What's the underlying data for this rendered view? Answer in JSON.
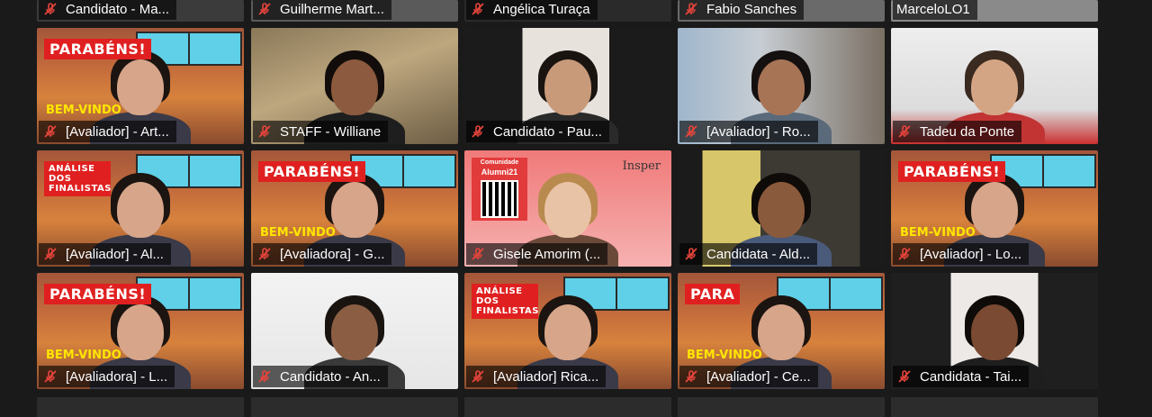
{
  "top_row": [
    {
      "name": "Candidato - Ma...",
      "muted": true
    },
    {
      "name": "Guilherme Mart...",
      "muted": true
    },
    {
      "name": "Angélica Turaça",
      "muted": true
    },
    {
      "name": "Fabio Sanches",
      "muted": true
    },
    {
      "name": "MarceloLO1",
      "muted": false
    }
  ],
  "tiles": [
    {
      "name": "[Avaliador] - Art...",
      "muted": true,
      "banner": "PARABÉNS!",
      "overlay": "BEM-VINDO",
      "theme": "room"
    },
    {
      "name": "STAFF - Williane",
      "muted": true,
      "theme": "office"
    },
    {
      "name": "Candidato - Pau...",
      "muted": true,
      "theme": "plain"
    },
    {
      "name": "[Avaliador] - Ro...",
      "muted": true,
      "theme": "home"
    },
    {
      "name": "Tadeu da Ponte",
      "muted": true,
      "theme": "white"
    },
    {
      "name": "[Avaliador] - Al...",
      "muted": true,
      "banner": "ANÁLISE DOS FINALISTAS",
      "theme": "room"
    },
    {
      "name": "[Avaliadora] - G...",
      "muted": true,
      "banner": "PARABÉNS!",
      "overlay": "BEM-VINDO",
      "theme": "room"
    },
    {
      "name": "Gisele Amorim (...",
      "muted": true,
      "theme": "alumni",
      "alumni_title": "Alumni21",
      "alumni_sub": "Comunidade",
      "brand": "Insper"
    },
    {
      "name": "Candidata - Ald...",
      "muted": true,
      "theme": "yellow"
    },
    {
      "name": "[Avaliador] - Lo...",
      "muted": true,
      "banner": "PARABÉNS!",
      "overlay": "BEM-VINDO",
      "theme": "room"
    },
    {
      "name": "[Avaliadora] - L...",
      "muted": true,
      "banner": "PARABÉNS!",
      "overlay": "BEM-VINDO",
      "theme": "room"
    },
    {
      "name": "Candidato - An...",
      "muted": true,
      "theme": "white2"
    },
    {
      "name": "[Avaliador] Rica...",
      "muted": true,
      "banner": "ANÁLISE DOS FINALISTAS",
      "theme": "room"
    },
    {
      "name": "[Avaliador] - Ce...",
      "muted": true,
      "banner": "PARA",
      "overlay": "BEM-VINDO",
      "theme": "room"
    },
    {
      "name": "Candidata - Tai...",
      "muted": true,
      "theme": "dark"
    }
  ],
  "icons": {
    "mute": "microphone-muted-icon"
  },
  "colors": {
    "mute_red": "#e8453c",
    "banner_red": "#e02020",
    "bemvindo_yellow": "#ffe600",
    "tile_bg": "#2b2b2b"
  }
}
